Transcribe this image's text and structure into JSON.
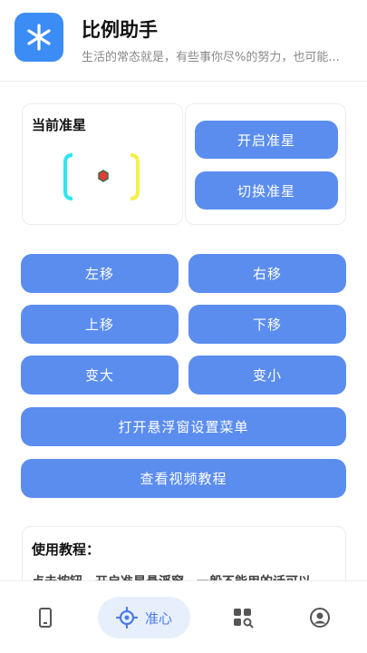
{
  "header": {
    "app_name": "比例助手",
    "subtitle": "生活的常态就是，有些事你尽%的努力，也可能..."
  },
  "crosshair": {
    "title": "当前准星",
    "bracket_left_color": "#2ee6f0",
    "bracket_right_color": "#f5f04a",
    "dot_color": "#e03c3c"
  },
  "controls": {
    "enable_label": "开启准星",
    "switch_label": "切换准星"
  },
  "moves": {
    "left_label": "左移",
    "right_label": "右移",
    "up_label": "上移",
    "down_label": "下移",
    "bigger_label": "变大",
    "smaller_label": "变小"
  },
  "actions": {
    "floating_menu_label": "打开悬浮窗设置菜单",
    "video_tutorial_label": "查看视频教程"
  },
  "tutorial": {
    "title": "使用教程：",
    "body": "点击按钮，开启准星悬浮窗，一般不能用的话可以..."
  },
  "tabbar": {
    "items": [
      {
        "name": "phone-tab",
        "icon": "phone-icon",
        "label": ""
      },
      {
        "name": "crosshair-tab",
        "icon": "target-icon",
        "label": "准心",
        "active": true
      },
      {
        "name": "tools-tab",
        "icon": "grid-search-icon",
        "label": ""
      },
      {
        "name": "profile-tab",
        "icon": "user-icon",
        "label": ""
      }
    ],
    "accent": "#4a7be8"
  },
  "colors": {
    "primary_button": "#5b8def",
    "logo_bg": "#3b8cf5"
  }
}
